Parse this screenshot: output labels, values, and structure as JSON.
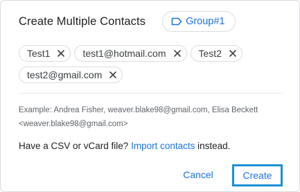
{
  "dialog": {
    "title": "Create Multiple Contacts",
    "label_chip": "Group#1"
  },
  "contacts": [
    {
      "label": "Test1"
    },
    {
      "label": "test1@hotmail.com"
    },
    {
      "label": "Test2"
    },
    {
      "label": "test2@gmail.com"
    }
  ],
  "example": {
    "line1": "Example: Andrea Fisher, weaver.blake98@gmail.com, Elisa Beckett",
    "line2": "<weaver.blake98@gmail.com>"
  },
  "csv": {
    "prefix": "Have a CSV or vCard file? ",
    "link": "Import contacts",
    "suffix": " instead."
  },
  "buttons": {
    "cancel": "Cancel",
    "create": "Create"
  },
  "icons": {
    "label": "label-outline-icon",
    "chip_remove": "close-icon"
  },
  "colors": {
    "accent": "#1a73e8",
    "focus_ring": "#1a8fd6",
    "border": "#dadce0"
  }
}
